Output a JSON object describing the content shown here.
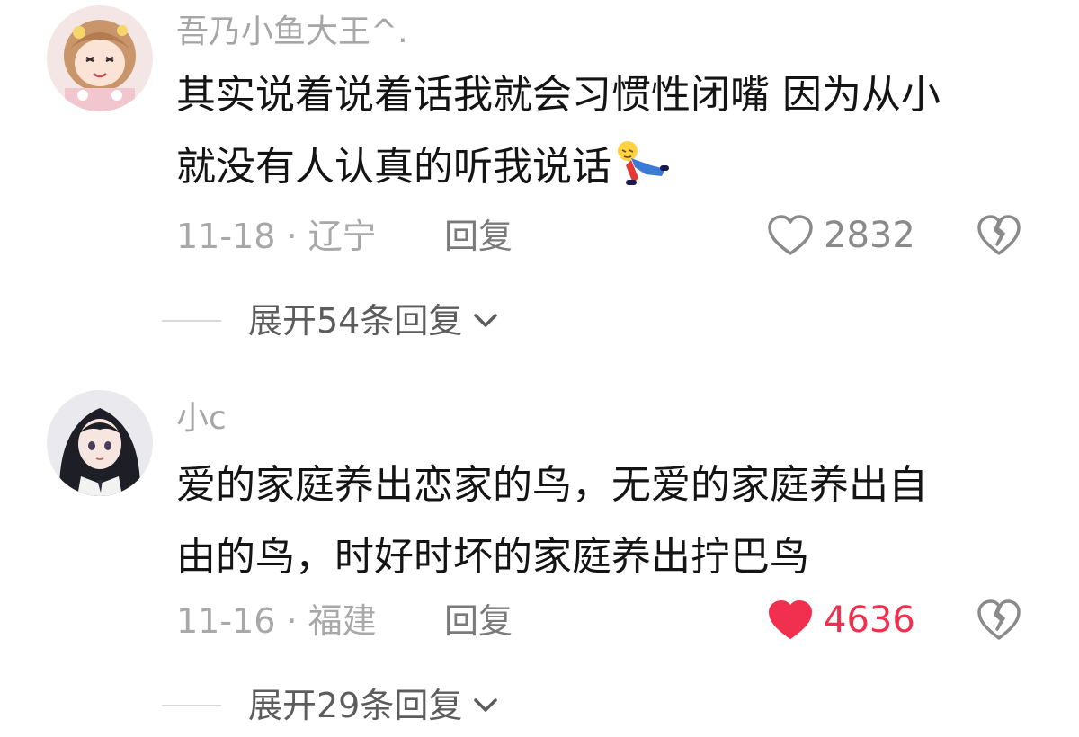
{
  "comments": [
    {
      "username": "吾乃小鱼大王^.",
      "text_line1": "其实说着说着话我就会习惯性闭嘴 因为从小",
      "text_line2": "就没有人认真的听我说话",
      "date_location": "11-18 · 辽宁",
      "reply_label": "回复",
      "likes": "2832",
      "liked": false,
      "expand_label": "展开54条回复",
      "avatar_icon": "anime-girl-avatar-pink",
      "emoji_icon": "fallen-person-emoji"
    },
    {
      "username": "小c",
      "text_line1": "爱的家庭养出恋家的鸟，无爱的家庭养出自",
      "text_line2": "由的鸟，时好时坏的家庭养出拧巴鸟",
      "date_location": "11-16 · 福建",
      "reply_label": "回复",
      "likes": "4636",
      "liked": true,
      "expand_label": "展开29条回复",
      "avatar_icon": "anime-girl-avatar-dark-hair"
    }
  ],
  "colors": {
    "like_active": "#f0304e",
    "meta_gray": "#a8a8a8"
  }
}
